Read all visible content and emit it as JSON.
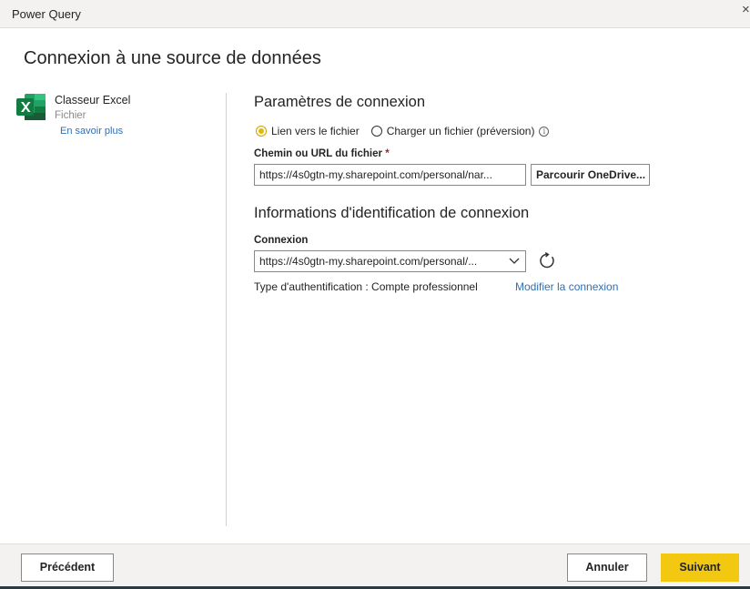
{
  "window": {
    "title": "Power Query",
    "close_glyph": "×"
  },
  "page": {
    "heading": "Connexion à une source de données"
  },
  "source": {
    "icon": "excel-icon",
    "name": "Classeur Excel",
    "type": "Fichier",
    "learn_more": "En savoir plus"
  },
  "connection_settings": {
    "title": "Paramètres de connexion",
    "radio_link": "Lien vers le fichier",
    "radio_upload": "Charger un fichier (préversion)",
    "selected": "Lien vers le fichier",
    "path_label": "Chemin ou URL du fichier",
    "required_mark": "*",
    "path_value": "https://4s0gtn-my.sharepoint.com/personal/nar...",
    "browse_button": "Parcourir OneDrive..."
  },
  "credentials": {
    "title": "Informations d'identification de connexion",
    "connection_label": "Connexion",
    "connection_value": "https://4s0gtn-my.sharepoint.com/personal/...",
    "auth_type": "Type d'authentification : Compte professionnel",
    "modify_link": "Modifier la connexion"
  },
  "footer": {
    "previous": "Précédent",
    "cancel": "Annuler",
    "next": "Suivant"
  },
  "colors": {
    "accent": "#F2C811",
    "link": "#2F6FB5",
    "excel_green": "#107C41"
  }
}
